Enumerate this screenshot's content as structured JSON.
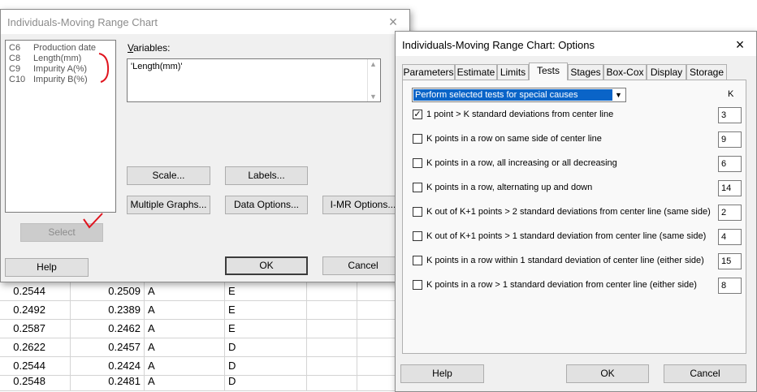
{
  "worksheet": {
    "rows": [
      [
        "0.2544",
        "0.2509",
        "A",
        "E"
      ],
      [
        "0.2492",
        "0.2389",
        "A",
        "E"
      ],
      [
        "0.2587",
        "0.2462",
        "A",
        "E"
      ],
      [
        "0.2622",
        "0.2457",
        "A",
        "D"
      ],
      [
        "0.2544",
        "0.2424",
        "A",
        "D"
      ],
      [
        "0.2548",
        "0.2481",
        "A",
        "D"
      ]
    ]
  },
  "main_dialog": {
    "title": "Individuals-Moving Range Chart",
    "close": "×",
    "variables_label": "Variables:",
    "variables_value": "'Length(mm)'",
    "columns": [
      {
        "col": "C6",
        "name": "Production date"
      },
      {
        "col": "C8",
        "name": "Length(mm)"
      },
      {
        "col": "C9",
        "name": "Impurity A(%)"
      },
      {
        "col": "C10",
        "name": "Impurity B(%)"
      }
    ],
    "buttons": {
      "scale": "Scale...",
      "labels": "Labels...",
      "multiple_graphs": "Multiple Graphs...",
      "data_options": "Data Options...",
      "imr_options": "I-MR Options...",
      "select": "Select",
      "help": "Help",
      "ok": "OK",
      "cancel": "Cancel"
    }
  },
  "options_dialog": {
    "title": "Individuals-Moving Range Chart: Options",
    "close": "×",
    "tabs": [
      "Parameters",
      "Estimate",
      "Limits",
      "Tests",
      "Stages",
      "Box-Cox",
      "Display",
      "Storage"
    ],
    "active_tab": "Tests",
    "dropdown_value": "Perform selected tests for special causes",
    "k_header": "K",
    "tests": [
      {
        "label": "1 point > K standard deviations from center line",
        "checked": true,
        "k": "3"
      },
      {
        "label": "K points in a row on same side of center line",
        "checked": false,
        "k": "9"
      },
      {
        "label": "K points in a row, all increasing or all decreasing",
        "checked": false,
        "k": "6"
      },
      {
        "label": "K points in a row, alternating up and down",
        "checked": false,
        "k": "14"
      },
      {
        "label": "K out of K+1 points > 2 standard deviations from center line (same side)",
        "checked": false,
        "k": "2"
      },
      {
        "label": "K out of K+1 points > 1 standard deviation from center line (same side)",
        "checked": false,
        "k": "4"
      },
      {
        "label": "K points in a row within 1 standard deviation of center line (either side)",
        "checked": false,
        "k": "15"
      },
      {
        "label": "K points in a row > 1 standard deviation from center line (either side)",
        "checked": false,
        "k": "8"
      }
    ],
    "buttons": {
      "help": "Help",
      "ok": "OK",
      "cancel": "Cancel"
    }
  },
  "colors": {
    "selection": "#0a64c8",
    "annotation": "#e0141e"
  }
}
